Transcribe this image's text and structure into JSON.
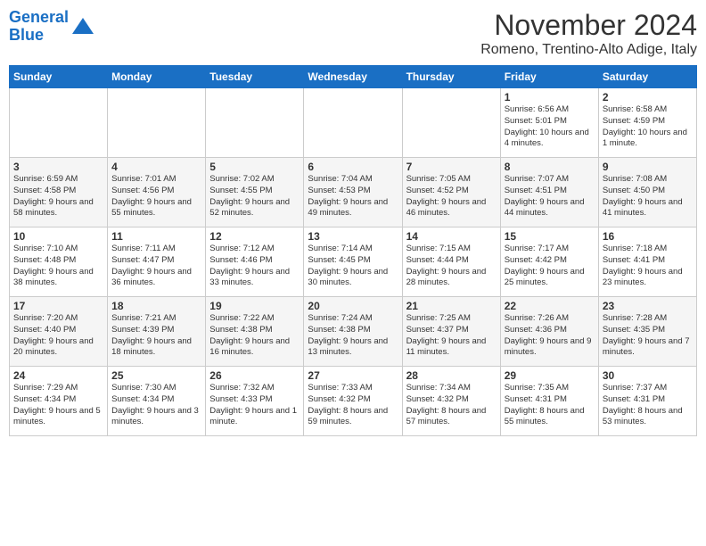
{
  "logo": {
    "line1": "General",
    "line2": "Blue"
  },
  "title": "November 2024",
  "location": "Romeno, Trentino-Alto Adige, Italy",
  "days_of_week": [
    "Sunday",
    "Monday",
    "Tuesday",
    "Wednesday",
    "Thursday",
    "Friday",
    "Saturday"
  ],
  "weeks": [
    [
      {
        "day": "",
        "info": ""
      },
      {
        "day": "",
        "info": ""
      },
      {
        "day": "",
        "info": ""
      },
      {
        "day": "",
        "info": ""
      },
      {
        "day": "",
        "info": ""
      },
      {
        "day": "1",
        "info": "Sunrise: 6:56 AM\nSunset: 5:01 PM\nDaylight: 10 hours and 4 minutes."
      },
      {
        "day": "2",
        "info": "Sunrise: 6:58 AM\nSunset: 4:59 PM\nDaylight: 10 hours and 1 minute."
      }
    ],
    [
      {
        "day": "3",
        "info": "Sunrise: 6:59 AM\nSunset: 4:58 PM\nDaylight: 9 hours and 58 minutes."
      },
      {
        "day": "4",
        "info": "Sunrise: 7:01 AM\nSunset: 4:56 PM\nDaylight: 9 hours and 55 minutes."
      },
      {
        "day": "5",
        "info": "Sunrise: 7:02 AM\nSunset: 4:55 PM\nDaylight: 9 hours and 52 minutes."
      },
      {
        "day": "6",
        "info": "Sunrise: 7:04 AM\nSunset: 4:53 PM\nDaylight: 9 hours and 49 minutes."
      },
      {
        "day": "7",
        "info": "Sunrise: 7:05 AM\nSunset: 4:52 PM\nDaylight: 9 hours and 46 minutes."
      },
      {
        "day": "8",
        "info": "Sunrise: 7:07 AM\nSunset: 4:51 PM\nDaylight: 9 hours and 44 minutes."
      },
      {
        "day": "9",
        "info": "Sunrise: 7:08 AM\nSunset: 4:50 PM\nDaylight: 9 hours and 41 minutes."
      }
    ],
    [
      {
        "day": "10",
        "info": "Sunrise: 7:10 AM\nSunset: 4:48 PM\nDaylight: 9 hours and 38 minutes."
      },
      {
        "day": "11",
        "info": "Sunrise: 7:11 AM\nSunset: 4:47 PM\nDaylight: 9 hours and 36 minutes."
      },
      {
        "day": "12",
        "info": "Sunrise: 7:12 AM\nSunset: 4:46 PM\nDaylight: 9 hours and 33 minutes."
      },
      {
        "day": "13",
        "info": "Sunrise: 7:14 AM\nSunset: 4:45 PM\nDaylight: 9 hours and 30 minutes."
      },
      {
        "day": "14",
        "info": "Sunrise: 7:15 AM\nSunset: 4:44 PM\nDaylight: 9 hours and 28 minutes."
      },
      {
        "day": "15",
        "info": "Sunrise: 7:17 AM\nSunset: 4:42 PM\nDaylight: 9 hours and 25 minutes."
      },
      {
        "day": "16",
        "info": "Sunrise: 7:18 AM\nSunset: 4:41 PM\nDaylight: 9 hours and 23 minutes."
      }
    ],
    [
      {
        "day": "17",
        "info": "Sunrise: 7:20 AM\nSunset: 4:40 PM\nDaylight: 9 hours and 20 minutes."
      },
      {
        "day": "18",
        "info": "Sunrise: 7:21 AM\nSunset: 4:39 PM\nDaylight: 9 hours and 18 minutes."
      },
      {
        "day": "19",
        "info": "Sunrise: 7:22 AM\nSunset: 4:38 PM\nDaylight: 9 hours and 16 minutes."
      },
      {
        "day": "20",
        "info": "Sunrise: 7:24 AM\nSunset: 4:38 PM\nDaylight: 9 hours and 13 minutes."
      },
      {
        "day": "21",
        "info": "Sunrise: 7:25 AM\nSunset: 4:37 PM\nDaylight: 9 hours and 11 minutes."
      },
      {
        "day": "22",
        "info": "Sunrise: 7:26 AM\nSunset: 4:36 PM\nDaylight: 9 hours and 9 minutes."
      },
      {
        "day": "23",
        "info": "Sunrise: 7:28 AM\nSunset: 4:35 PM\nDaylight: 9 hours and 7 minutes."
      }
    ],
    [
      {
        "day": "24",
        "info": "Sunrise: 7:29 AM\nSunset: 4:34 PM\nDaylight: 9 hours and 5 minutes."
      },
      {
        "day": "25",
        "info": "Sunrise: 7:30 AM\nSunset: 4:34 PM\nDaylight: 9 hours and 3 minutes."
      },
      {
        "day": "26",
        "info": "Sunrise: 7:32 AM\nSunset: 4:33 PM\nDaylight: 9 hours and 1 minute."
      },
      {
        "day": "27",
        "info": "Sunrise: 7:33 AM\nSunset: 4:32 PM\nDaylight: 8 hours and 59 minutes."
      },
      {
        "day": "28",
        "info": "Sunrise: 7:34 AM\nSunset: 4:32 PM\nDaylight: 8 hours and 57 minutes."
      },
      {
        "day": "29",
        "info": "Sunrise: 7:35 AM\nSunset: 4:31 PM\nDaylight: 8 hours and 55 minutes."
      },
      {
        "day": "30",
        "info": "Sunrise: 7:37 AM\nSunset: 4:31 PM\nDaylight: 8 hours and 53 minutes."
      }
    ]
  ]
}
